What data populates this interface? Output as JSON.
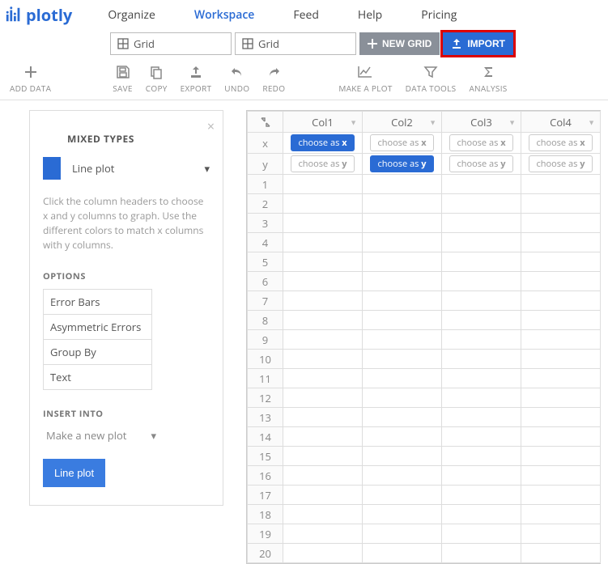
{
  "brand": "plotly",
  "nav": {
    "organize": "Organize",
    "workspace": "Workspace",
    "feed": "Feed",
    "help": "Help",
    "pricing": "Pricing"
  },
  "tabs": {
    "tab1": "Grid",
    "tab2": "Grid"
  },
  "buttons": {
    "new_grid": "NEW GRID",
    "import": "IMPORT"
  },
  "toolbar": {
    "add_data": "ADD DATA",
    "save": "SAVE",
    "copy": "COPY",
    "export": "EXPORT",
    "undo": "UNDO",
    "redo": "REDO",
    "make_plot": "MAKE A PLOT",
    "data_tools": "DATA TOOLS",
    "analysis": "ANALYSIS"
  },
  "panel": {
    "title": "MIXED TYPES",
    "plot_type": "Line plot",
    "hint": "Click the column headers to choose x and y columns to graph. Use the different colors to match x columns with y columns.",
    "options_label": "OPTIONS",
    "options": [
      "Error Bars",
      "Asymmetric Errors",
      "Group By",
      "Text"
    ],
    "insert_label": "INSERT INTO",
    "insert_select": "Make a new plot",
    "action": "Line plot"
  },
  "grid": {
    "cols": [
      "Col1",
      "Col2",
      "Col3",
      "Col4"
    ],
    "axis_x": "x",
    "axis_y": "y",
    "chip_x": "choose as x",
    "chip_y": "choose as y",
    "x_active_col": 0,
    "y_active_col": 1,
    "rows": 20
  }
}
